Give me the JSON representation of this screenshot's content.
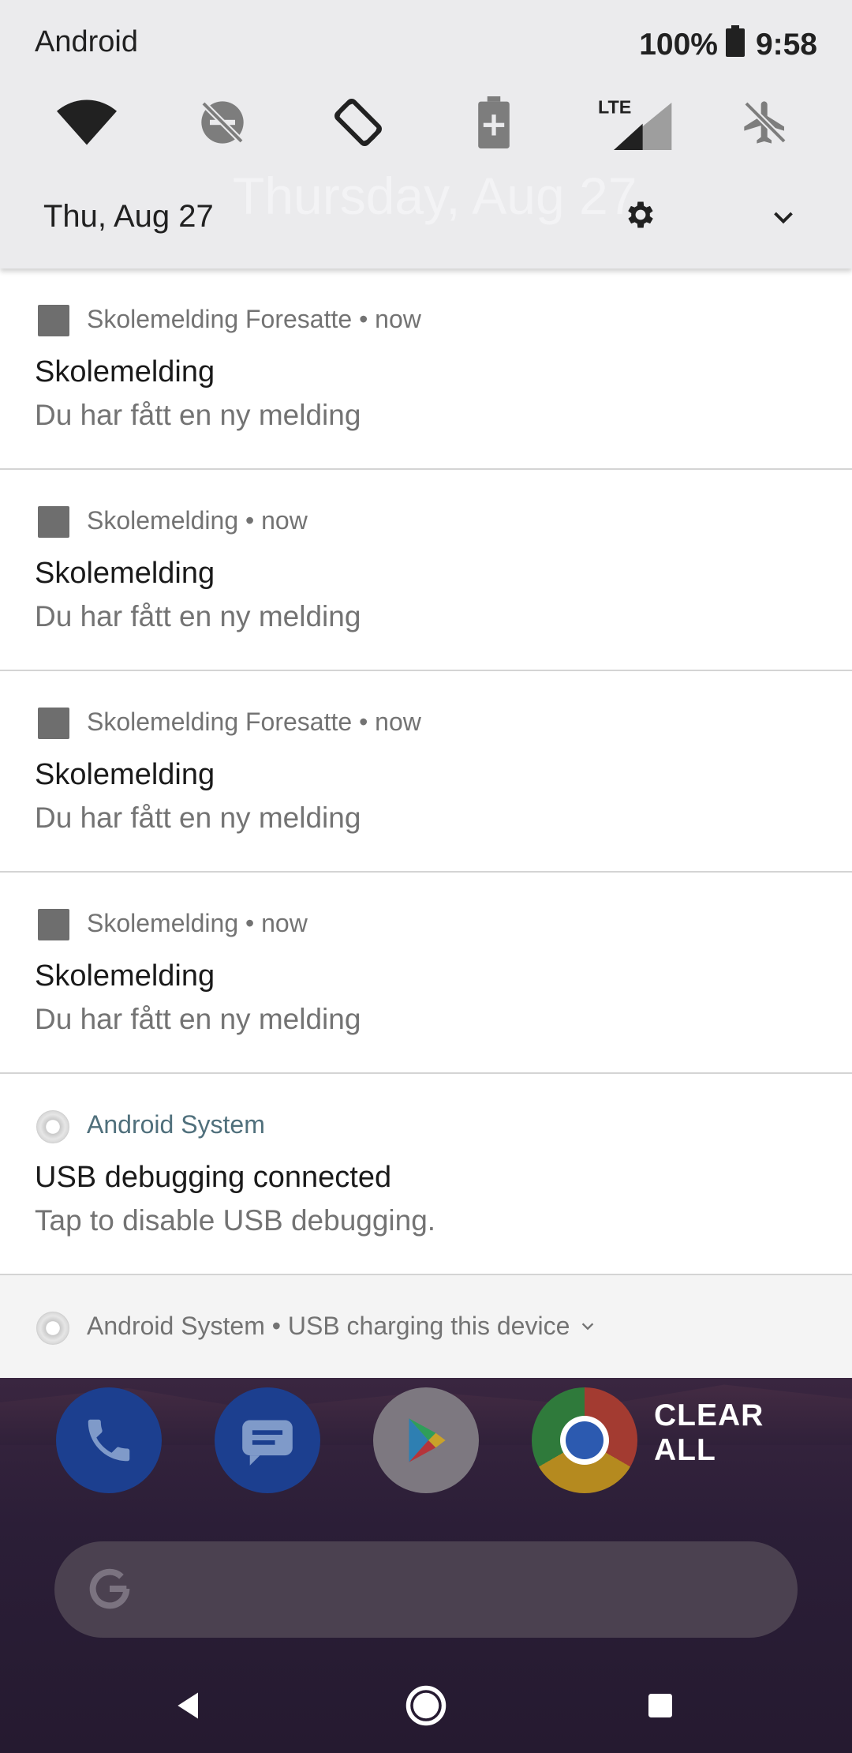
{
  "status_bar": {
    "carrier": "Android",
    "battery": "100%",
    "time": "9:58"
  },
  "quick_settings": {
    "tiles": [
      "wifi-icon",
      "do-not-disturb-off-icon",
      "auto-rotate-icon",
      "battery-saver-icon",
      "lte-signal-icon",
      "airplane-mode-off-icon"
    ],
    "date": "Thu, Aug 27",
    "ghost_date": "Thursday, Aug 27"
  },
  "notifications": [
    {
      "header": "Skolemelding Foresatte • now",
      "title": "Skolemelding",
      "body": "Du har fått en ny melding"
    },
    {
      "header": "Skolemelding • now",
      "title": "Skolemelding",
      "body": "Du har fått en ny melding"
    },
    {
      "header": "Skolemelding Foresatte • now",
      "title": "Skolemelding",
      "body": "Du har fått en ny melding"
    },
    {
      "header": "Skolemelding • now",
      "title": "Skolemelding",
      "body": "Du har fått en ny melding"
    },
    {
      "header": "Android System",
      "title": "USB debugging connected",
      "body": "Tap to disable USB debugging."
    }
  ],
  "summary": {
    "header": "Android System • USB charging this device"
  },
  "home": {
    "clear_all": "CLEAR ALL",
    "dock": [
      "phone-icon",
      "messages-icon",
      "play-store-icon",
      "chrome-icon"
    ]
  },
  "colors": {
    "qs_background": "#ebebed",
    "system_app_name": "#50707c",
    "home_background": "#2a1d33"
  }
}
